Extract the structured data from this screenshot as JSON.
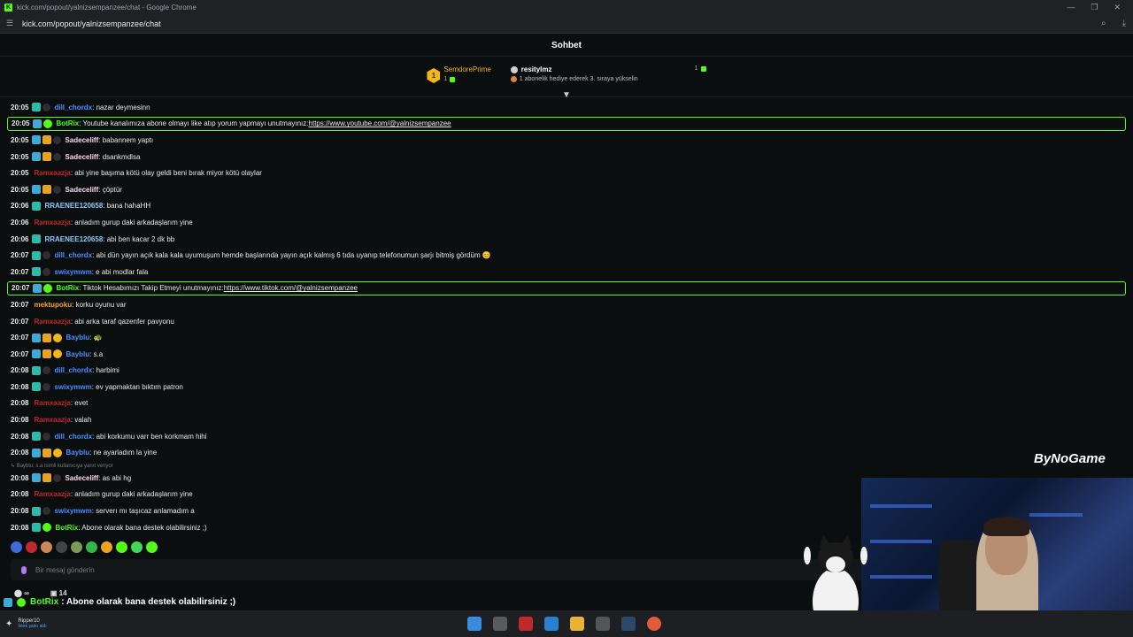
{
  "window": {
    "title": "kick.com/popout/yalnizsempanzee/chat - Google Chrome",
    "url": "kick.com/popout/yalnizsempanzee/chat"
  },
  "chat": {
    "header": "Sohbet",
    "input_placeholder": "Bir mesaj gönderin",
    "scroll_icon": "scroll-down-icon"
  },
  "leaderboard": {
    "first": {
      "rank": "1",
      "name": "SemdorePrime",
      "count": "1"
    },
    "second": {
      "name": "resitylmz",
      "count": "1",
      "hint": "1 abonelik hediye ederek 3. sıraya yükselin"
    }
  },
  "messages": [
    {
      "time": "20:05",
      "badges": [
        "teal",
        "dark"
      ],
      "user": "dill_chordx",
      "user_color": "#4a8dff",
      "text": ": nazar deymesinn"
    },
    {
      "time": "20:05",
      "badges": [
        "cyan",
        "green"
      ],
      "user": "BotRix",
      "user_color": "#53fc18",
      "text": ": Youtube kanalımıza abone olmayı like atıp yorum yapmayı unutmayınız: ",
      "link": "https://www.youtube.com/@yalnizsempanzee",
      "pinned": true
    },
    {
      "time": "20:05",
      "badges": [
        "cyan",
        "gold",
        "dark"
      ],
      "user": "Sadeceliff",
      "user_color": "#ffd6f0",
      "text": ": babannem yaptı"
    },
    {
      "time": "20:05",
      "badges": [
        "cyan",
        "gold",
        "dark"
      ],
      "user": "Sadeceliff",
      "user_color": "#ffd6f0",
      "text": ": dsankmdlsa"
    },
    {
      "time": "20:05",
      "badges": [],
      "user": "Ramxaazja",
      "user_color": "#c0282d",
      "text": ": abi yine başıma kötü olay geldi beni bırak miyor kötü olaylar"
    },
    {
      "time": "20:05",
      "badges": [
        "cyan",
        "gold",
        "dark"
      ],
      "user": "Sadeceliff",
      "user_color": "#ffd6f0",
      "text": ": çöptür"
    },
    {
      "time": "20:06",
      "badges": [
        "teal"
      ],
      "user": "RRAENEE120658",
      "user_color": "#8fc7ff",
      "text": ": bana hahaHH"
    },
    {
      "time": "20:06",
      "badges": [],
      "user": "Ramxaazja",
      "user_color": "#c0282d",
      "text": ": anladım gurup daki arkadaşlarım yine"
    },
    {
      "time": "20:06",
      "badges": [
        "teal"
      ],
      "user": "RRAENEE120658",
      "user_color": "#8fc7ff",
      "text": ": abi ben kacar 2 dk bb"
    },
    {
      "time": "20:07",
      "badges": [
        "teal",
        "dark"
      ],
      "user": "dill_chordx",
      "user_color": "#4a8dff",
      "text": ": abi dün yayın açık kala kala uyumuşum hemde başlarında yayın açık kalmış 6 tıda uyanıp telefonumun şarjı bitmiş gördüm 😊"
    },
    {
      "time": "20:07",
      "badges": [
        "teal",
        "dark"
      ],
      "user": "swixymwm",
      "user_color": "#4a8dff",
      "text": ": e abi modlar fala"
    },
    {
      "time": "20:07",
      "badges": [
        "cyan",
        "green"
      ],
      "user": "BotRix",
      "user_color": "#53fc18",
      "text": ": Tiktok Hesabımızı Takip Etmeyi unutmayınız: ",
      "link": "https://www.tiktok.com/@yalnizsempanzee",
      "pinned": true
    },
    {
      "time": "20:07",
      "badges": [],
      "user": "mektupoku",
      "user_color": "#f2a23a",
      "text": ": korku oyunu var"
    },
    {
      "time": "20:07",
      "badges": [],
      "user": "Ramxaazja",
      "user_color": "#c0282d",
      "text": ": abi arka taraf qazenfer pavyonu"
    },
    {
      "time": "20:07",
      "badges": [
        "cyan",
        "gold",
        "coin"
      ],
      "user": "Bayblu",
      "user_color": "#4a8dff",
      "text": ": 🐢"
    },
    {
      "time": "20:07",
      "badges": [
        "cyan",
        "gold",
        "coin"
      ],
      "user": "Bayblu",
      "user_color": "#4a8dff",
      "text": ": s.a"
    },
    {
      "time": "20:08",
      "badges": [
        "teal",
        "dark"
      ],
      "user": "dill_chordx",
      "user_color": "#4a8dff",
      "text": ": harbimi"
    },
    {
      "time": "20:08",
      "badges": [
        "teal",
        "dark"
      ],
      "user": "swixymwm",
      "user_color": "#4a8dff",
      "text": ": ev yapmaktan bıktım patron"
    },
    {
      "time": "20:08",
      "badges": [],
      "user": "Ramxaazja",
      "user_color": "#c0282d",
      "text": ": evet"
    },
    {
      "time": "20:08",
      "badges": [],
      "user": "Ramxaazja",
      "user_color": "#c0282d",
      "text": ": valah"
    },
    {
      "time": "20:08",
      "badges": [
        "teal",
        "dark"
      ],
      "user": "dill_chordx",
      "user_color": "#4a8dff",
      "text": ": abi korkumu varr ben korkmam hihi"
    },
    {
      "time": "20:08",
      "badges": [
        "cyan",
        "gold",
        "coin"
      ],
      "user": "Bayblu",
      "user_color": "#4a8dff",
      "text": ": ne ayarladım la yine"
    },
    {
      "time": "20:08",
      "badges": [
        "cyan",
        "gold",
        "dark"
      ],
      "user": "Sadeceliff",
      "user_color": "#ffd6f0",
      "text": ": as abi hg",
      "reply": "↳ Bayblu: s.a isimli kullanıcıya yanıt veriyor"
    },
    {
      "time": "20:08",
      "badges": [],
      "user": "Ramxaazja",
      "user_color": "#c0282d",
      "text": ": anladım gurup daki arkadaşlarım yine"
    },
    {
      "time": "20:08",
      "badges": [
        "teal",
        "dark"
      ],
      "user": "swixymwm",
      "user_color": "#4a8dff",
      "text": ": serverı mı taşıcaz anlamadım a"
    },
    {
      "time": "20:08",
      "badges": [
        "teal",
        "green"
      ],
      "user": "BotRix",
      "user_color": "#53fc18",
      "text": ": Abone olarak bana destek olabilirsiniz ;)"
    }
  ],
  "stats": {
    "viewers": "∞",
    "count": "14"
  },
  "overlay": {
    "user": "BotRix",
    "text": ": Abone olarak bana destek olabilirsiniz ;)"
  },
  "watermark": "ByNoGame",
  "taskbar": {
    "user": "Ripper10",
    "user_sub": "İstek şarkı aldı"
  },
  "colors": {
    "accent": "#53fc18",
    "background": "#0b0e0f"
  }
}
